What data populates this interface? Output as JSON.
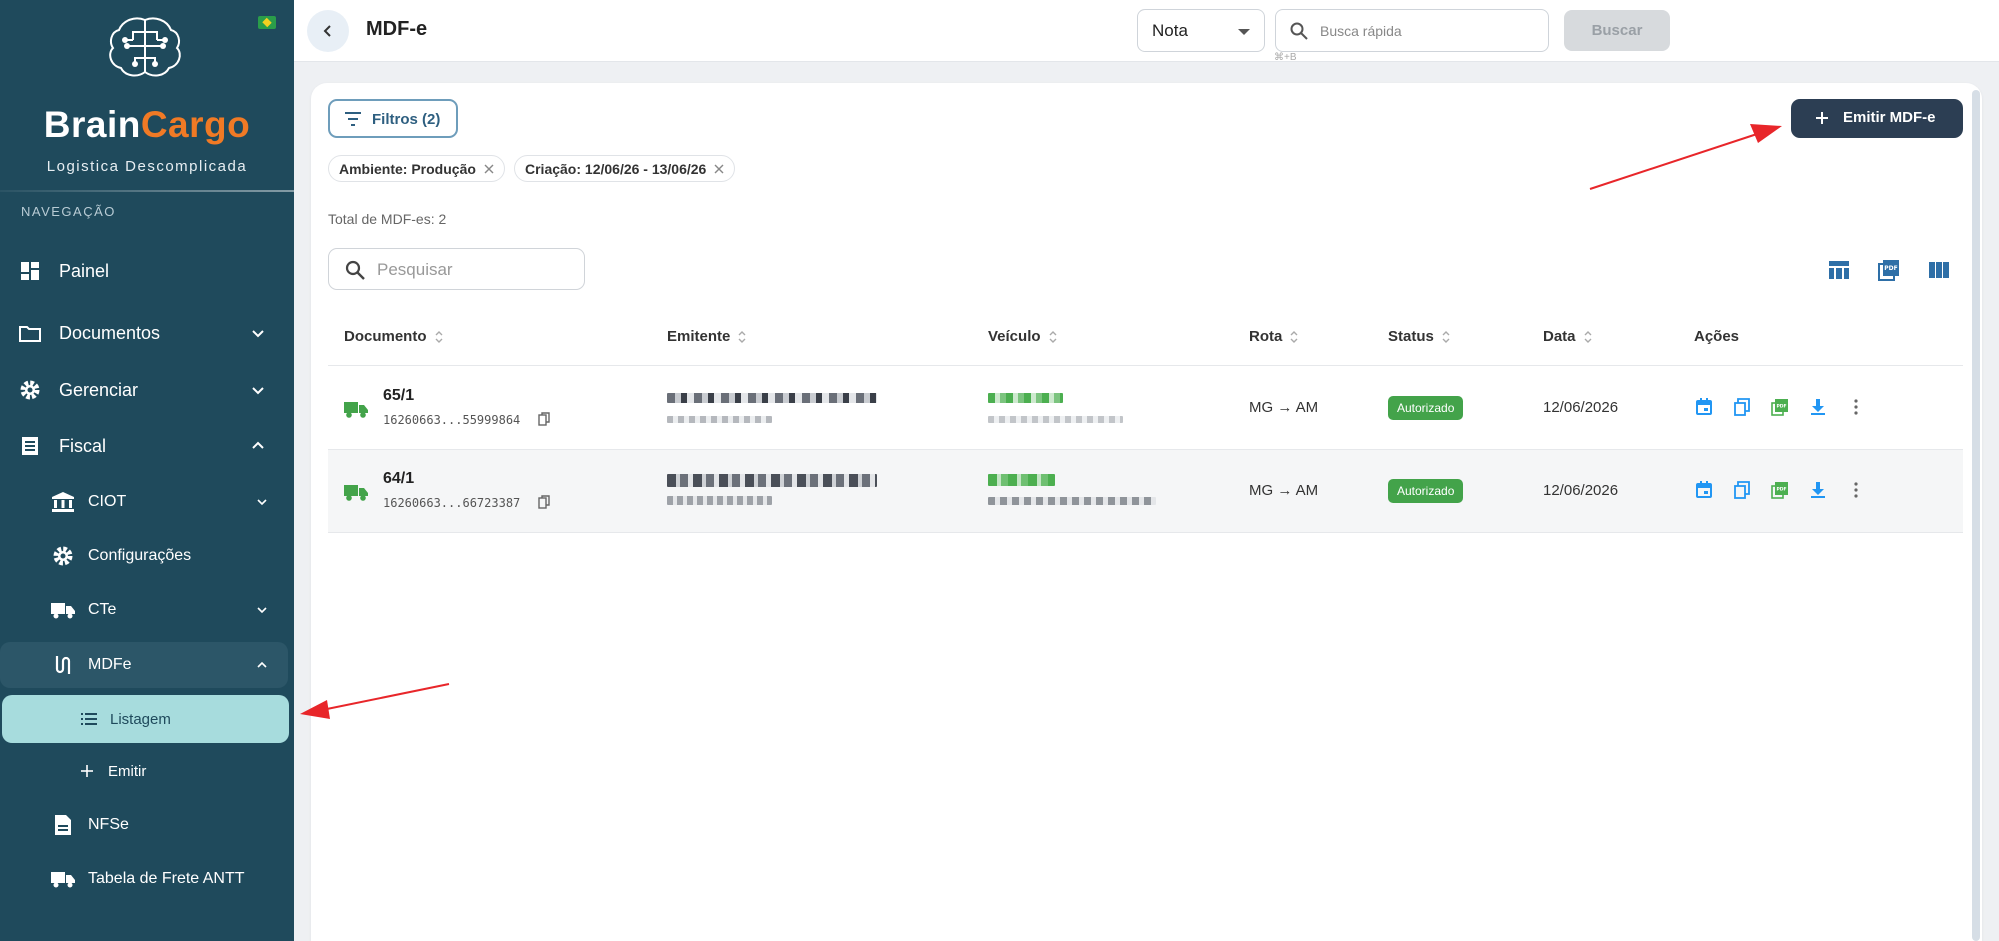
{
  "sidebar": {
    "brand_part1": "Brain",
    "brand_part2": "Cargo",
    "tagline": "Logistica Descomplicada",
    "nav_heading": "NAVEGAÇÃO",
    "items": {
      "painel": "Painel",
      "documentos": "Documentos",
      "gerenciar": "Gerenciar",
      "fiscal": "Fiscal",
      "ciot": "CIOT",
      "configuracoes": "Configurações",
      "cte": "CTe",
      "mdfe": "MDFe",
      "listagem": "Listagem",
      "emitir": "Emitir",
      "nfse": "NFSe",
      "tabela_frete": "Tabela de Frete ANTT"
    },
    "colors": {
      "background": "#1f4a5c",
      "active_item": "#a7dcdd",
      "brand_accent": "#f07a25"
    }
  },
  "header": {
    "title": "MDF-e",
    "type_select": {
      "value": "Nota"
    },
    "quick_search": {
      "placeholder": "Busca rápida",
      "shortcut": "⌘+B"
    },
    "search_button": "Buscar"
  },
  "main": {
    "filters_button": "Filtros (2)",
    "emit_button": "Emitir MDF-e",
    "chips": [
      "Ambiente: Produção",
      "Criação: 12/06/26 - 13/06/26"
    ],
    "total": "Total de MDF-es: 2",
    "search_placeholder": "Pesquisar",
    "table": {
      "columns": [
        "Documento",
        "Emitente",
        "Veículo",
        "Rota",
        "Status",
        "Data",
        "Ações"
      ],
      "rows": [
        {
          "documento": "65/1",
          "chave": "16260663...55999864",
          "rota": "MG → AM",
          "status": "Autorizado",
          "data": "12/06/2026"
        },
        {
          "documento": "64/1",
          "chave": "16260663...66723387",
          "rota": "MG → AM",
          "status": "Autorizado",
          "data": "12/06/2026"
        }
      ]
    },
    "colors": {
      "status_authorized": "#43a34a",
      "primary_button": "#2c3e53",
      "annotation_arrow": "#e8262a"
    }
  }
}
